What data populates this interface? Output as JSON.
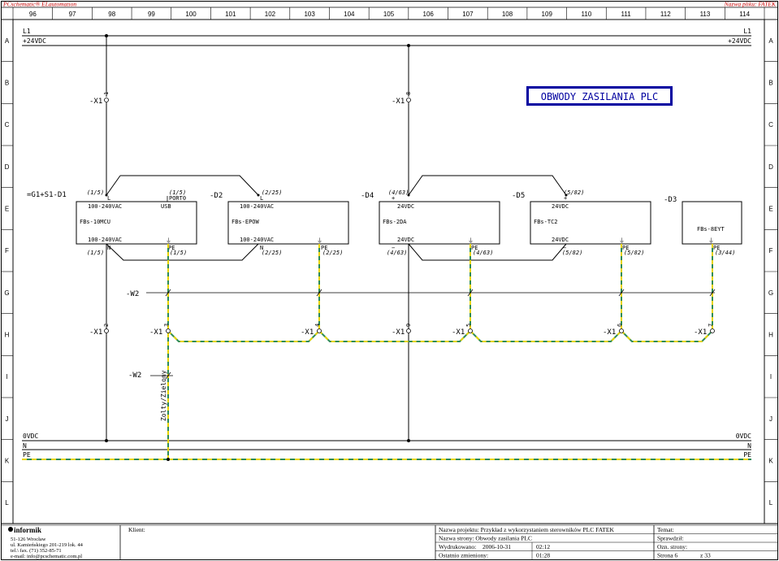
{
  "header": {
    "left": "PCschematic® ELautomation",
    "right": "Nazwa pliku: FATEK"
  },
  "columns": [
    "96",
    "97",
    "98",
    "99",
    "100",
    "101",
    "102",
    "103",
    "104",
    "105",
    "106",
    "107",
    "108",
    "109",
    "110",
    "111",
    "112",
    "113",
    "114"
  ],
  "rows": [
    "A",
    "B",
    "C",
    "D",
    "E",
    "F",
    "G",
    "H",
    "I",
    "J",
    "K",
    "L"
  ],
  "rails": {
    "l1_left": "L1",
    "l1_right": "L1",
    "v24_left": "+24VDC",
    "v24_right": "+24VDC",
    "v0_left": "0VDC",
    "v0_right": "0VDC",
    "n_left": "N",
    "n_right": "N",
    "pe_left": "PE",
    "pe_right": "PE"
  },
  "title": "OBWODY ZASILANIA PLC",
  "location": "=G1+S1-D1",
  "terminals": {
    "x1_1": {
      "label": "-X1",
      "num": "1"
    },
    "x1_8": {
      "label": "-X1",
      "num": "8"
    },
    "x1_2": {
      "label": "-X1",
      "num": "2"
    },
    "x1_3": {
      "label": "-X1",
      "num": "3"
    },
    "x1_4": {
      "label": "-X1",
      "num": "4"
    },
    "x1_9": {
      "label": "-X1",
      "num": "9"
    },
    "x1_5": {
      "label": "-X1",
      "num": "5"
    },
    "x1_6": {
      "label": "-X1",
      "num": "6"
    },
    "x1_7": {
      "label": "-X1",
      "num": "7"
    }
  },
  "cables": {
    "w2_top": "-W2",
    "w2_bottom": "-W2",
    "wire_color": "Zolty/Zielony"
  },
  "devices": {
    "d1": {
      "name": "FBs-10MCU",
      "top_ref_l": "(1/5)",
      "top_l": "L",
      "top_v": "100-240VAC",
      "top_ref_port": "(1/5)",
      "port": "PORT0",
      "usb": "USB",
      "bot_v": "100-240VAC",
      "bot_n": "N",
      "bot_ref_n": "(1/5)",
      "bot_pe": "PE",
      "bot_ref_pe": "(1/5)"
    },
    "d2": {
      "tag": "-D2",
      "name": "FBs-EPOW",
      "top_ref": "(2/25)",
      "top_l": "L",
      "top_v": "100-240VAC",
      "bot_v": "100-240VAC",
      "bot_n": "N",
      "bot_ref_n": "(2/25)",
      "bot_pe": "PE",
      "bot_ref_pe": "(2/25)"
    },
    "d4": {
      "tag": "-D4",
      "name": "FBs-2DA",
      "top_ref": "(4/63)",
      "top_plus": "+",
      "top_v": "24VDC",
      "bot_v": "24VDC",
      "bot_minus": "−",
      "bot_ref_minus": "(4/63)",
      "bot_pe": "PE",
      "bot_ref_pe": "(4/63)"
    },
    "d5": {
      "tag": "-D5",
      "name": "FBs-TC2",
      "top_ref": "(5/82)",
      "top_plus": "+",
      "top_v": "24VDC",
      "bot_v": "24VDC",
      "bot_minus": "−",
      "bot_ref_minus": "(5/82)",
      "bot_pe": "PE",
      "bot_ref_pe": "(5/82)"
    },
    "d3": {
      "tag": "-D3",
      "name": "FBs-8EYT",
      "bot_pe": "PE",
      "bot_ref_pe": "(3/44)"
    }
  },
  "footer": {
    "company": "informik",
    "addr1": "51-126 Wrocław",
    "addr2": "ul. Kamieńskiego 201-219 lok. 44",
    "addr3": "tel.\\ fax. (71) 352-85-71",
    "addr4": "e-mail: info@pcschematic.com.pl",
    "client_label": "Klient:",
    "project": "Nazwa projektu:  Przykład z wykorzystaniem sterowników PLC  FATEK",
    "page_name": "Nazwa strony: Obwody zasilania PLC",
    "printed_label": "Wydrukowano:",
    "printed_date": "2006-10-31",
    "printed_time": "02:12",
    "changed_label": "Ostatnio zmieniony:",
    "changed_time": "01:28",
    "subject": "Temat:",
    "checked": "Sprawdził:",
    "pages_label": "Ozn. strony:",
    "page": "Strona 6",
    "of": "z  33"
  },
  "colors": {
    "line": "#000000",
    "pe_green": "#2e8b57",
    "pe_yellow": "#e8d400",
    "title_box": "#0000a0",
    "red": "#cc0000"
  }
}
